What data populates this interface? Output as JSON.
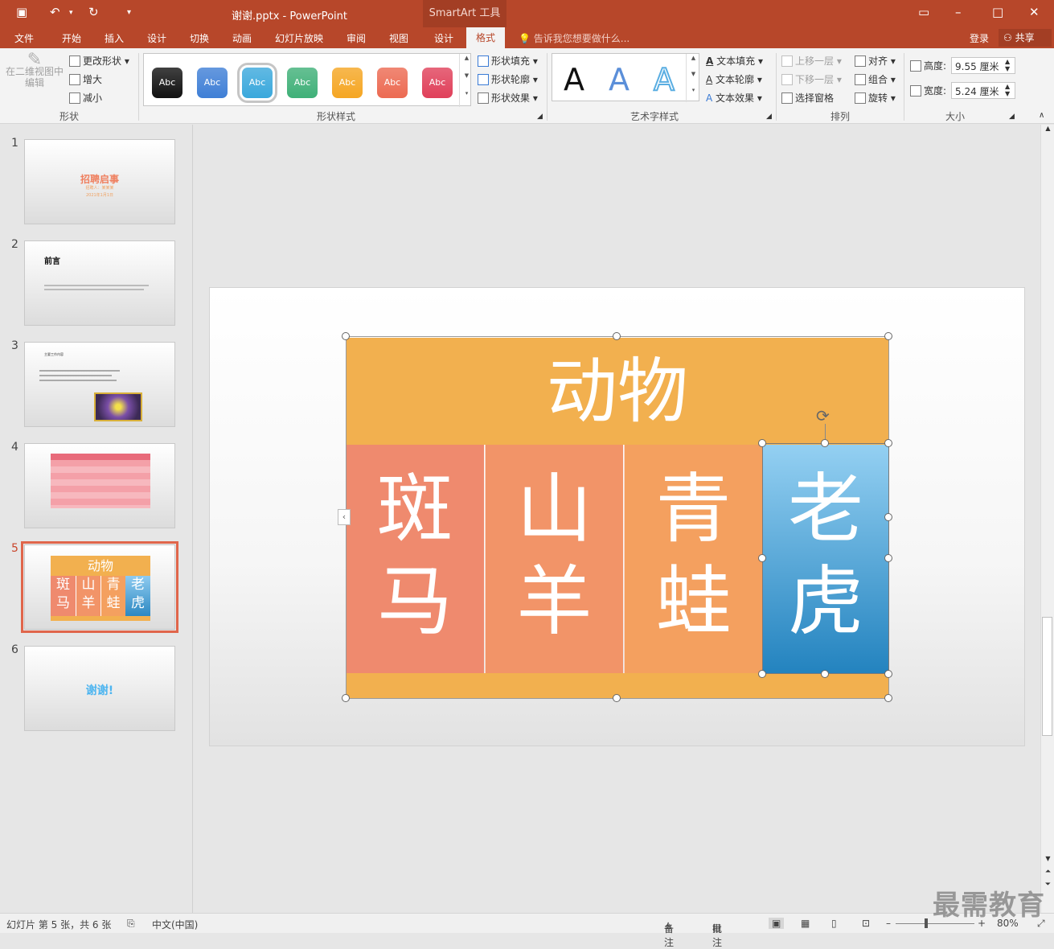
{
  "app": {
    "title": "谢谢.pptx - PowerPoint",
    "smartart_tool": "SmartArt 工具"
  },
  "tabs": [
    "文件",
    "开始",
    "插入",
    "设计",
    "切换",
    "动画",
    "幻灯片放映",
    "审阅",
    "视图",
    "设计",
    "格式"
  ],
  "tell_me": "告诉我您想要做什么...",
  "account": {
    "login": "登录",
    "share": "共享"
  },
  "ribbon": {
    "shape_group": {
      "label": "形状",
      "edit_2d": "在二维视图中编辑",
      "change_shape": "更改形状",
      "larger": "增大",
      "smaller": "减小"
    },
    "shape_styles": {
      "label": "形状样式",
      "swatch_text": "Abc",
      "fill": "形状填充",
      "outline": "形状轮廓",
      "effects": "形状效果",
      "swatches": [
        "#111111",
        "#3f7fd6",
        "#3aa8dc",
        "#3fb078",
        "#f5a623",
        "#ec6a52",
        "#e0405a"
      ]
    },
    "wordart": {
      "label": "艺术字样式",
      "letter": "A",
      "text_fill": "文本填充",
      "text_outline": "文本轮廓",
      "text_effects": "文本效果"
    },
    "arrange": {
      "label": "排列",
      "forward": "上移一层",
      "backward": "下移一层",
      "selection_pane": "选择窗格",
      "align": "对齐",
      "group": "组合",
      "rotate": "旋转"
    },
    "size": {
      "label": "大小",
      "height_label": "高度:",
      "height_value": "9.55 厘米",
      "width_label": "宽度:",
      "width_value": "5.24 厘米"
    }
  },
  "slides": [
    {
      "num": "1",
      "title": "招聘启事",
      "sub": "招聘人：某某某",
      "date": "2021年1月1日"
    },
    {
      "num": "2",
      "title": "前言"
    },
    {
      "num": "3",
      "title": "主要工作内容"
    },
    {
      "num": "4",
      "title": ""
    },
    {
      "num": "5",
      "title": "动物"
    },
    {
      "num": "6",
      "title": "谢谢!"
    }
  ],
  "thumb5": {
    "title": "动物",
    "cells": [
      [
        "斑",
        "马"
      ],
      [
        "山",
        "羊"
      ],
      [
        "青",
        "蛙"
      ],
      [
        "老",
        "虎"
      ]
    ]
  },
  "smartart": {
    "title": "动物",
    "cells": [
      {
        "top": "斑",
        "bottom": "马",
        "color": "#ef8a6e"
      },
      {
        "top": "山",
        "bottom": "羊",
        "color": "#f29468"
      },
      {
        "top": "青",
        "bottom": "蛙",
        "color": "#f4a05f"
      },
      {
        "top": "老",
        "bottom": "虎",
        "color": "#3aa0d8"
      }
    ]
  },
  "status": {
    "slide_info": "幻灯片 第 5 张，共 6 张",
    "lang": "中文(中国)",
    "notes": "备注",
    "comments": "批注",
    "zoom": "80%"
  },
  "watermark": "最需教育"
}
